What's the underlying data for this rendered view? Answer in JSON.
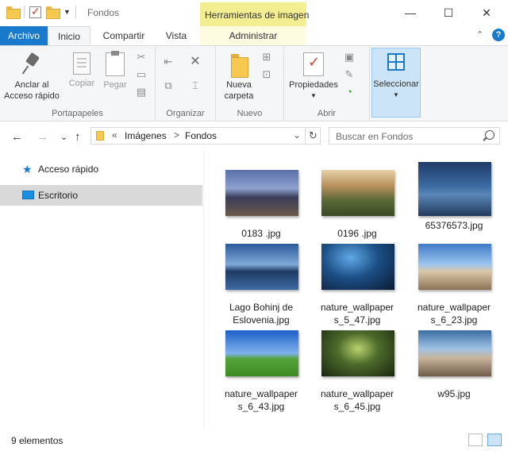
{
  "window": {
    "title": "Fondos",
    "context_tab_header": "Herramientas de imagen",
    "minimize": "—",
    "maximize": "☐",
    "close": "✕"
  },
  "tabs": {
    "archivo": "Archivo",
    "inicio": "Inicio",
    "compartir": "Compartir",
    "vista": "Vista",
    "administrar": "Administrar",
    "collapse": "⌃",
    "help": "?"
  },
  "ribbon": {
    "portapapeles": {
      "label": "Portapapeles",
      "pin_line1": "Anclar al",
      "pin_line2": "Acceso rápido",
      "copy": "Copiar",
      "paste": "Pegar"
    },
    "organizar": {
      "label": "Organizar"
    },
    "nuevo": {
      "label": "Nuevo",
      "new_folder_line1": "Nueva",
      "new_folder_line2": "carpeta"
    },
    "abrir": {
      "label": "Abrir",
      "properties": "Propiedades"
    },
    "seleccionar": {
      "label": "Seleccionar"
    }
  },
  "address": {
    "overflow": "«",
    "crumbs": [
      "Imágenes",
      "Fondos"
    ],
    "sep": ">",
    "dropdown": "⌄",
    "refresh": "↻"
  },
  "search": {
    "placeholder": "Buscar en Fondos"
  },
  "nav": {
    "back": "←",
    "forward": "→",
    "recent": "⌄",
    "up": "↑",
    "items": [
      {
        "label": "Acceso rápido",
        "icon": "star-icon"
      },
      {
        "label": "Escritorio",
        "icon": "desktop-icon",
        "selected": true
      }
    ]
  },
  "files": [
    {
      "line1": "0183 .jpg",
      "line2": ""
    },
    {
      "line1": "0196 .jpg",
      "line2": ""
    },
    {
      "line1": "65376573.jpg",
      "line2": ""
    },
    {
      "line1": "Lago Bohinj de",
      "line2": "Eslovenia.jpg"
    },
    {
      "line1": "nature_wallpaper",
      "line2": "s_5_47.jpg"
    },
    {
      "line1": "nature_wallpaper",
      "line2": "s_6_23.jpg"
    },
    {
      "line1": "nature_wallpaper",
      "line2": "s_6_43.jpg"
    },
    {
      "line1": "nature_wallpaper",
      "line2": "s_6_45.jpg"
    },
    {
      "line1": "w95.jpg",
      "line2": ""
    }
  ],
  "status": {
    "count": "9 elementos"
  },
  "colors": {
    "accent": "#1979ca",
    "context_tab": "#f4ee92",
    "selection": "#cce4f7"
  }
}
